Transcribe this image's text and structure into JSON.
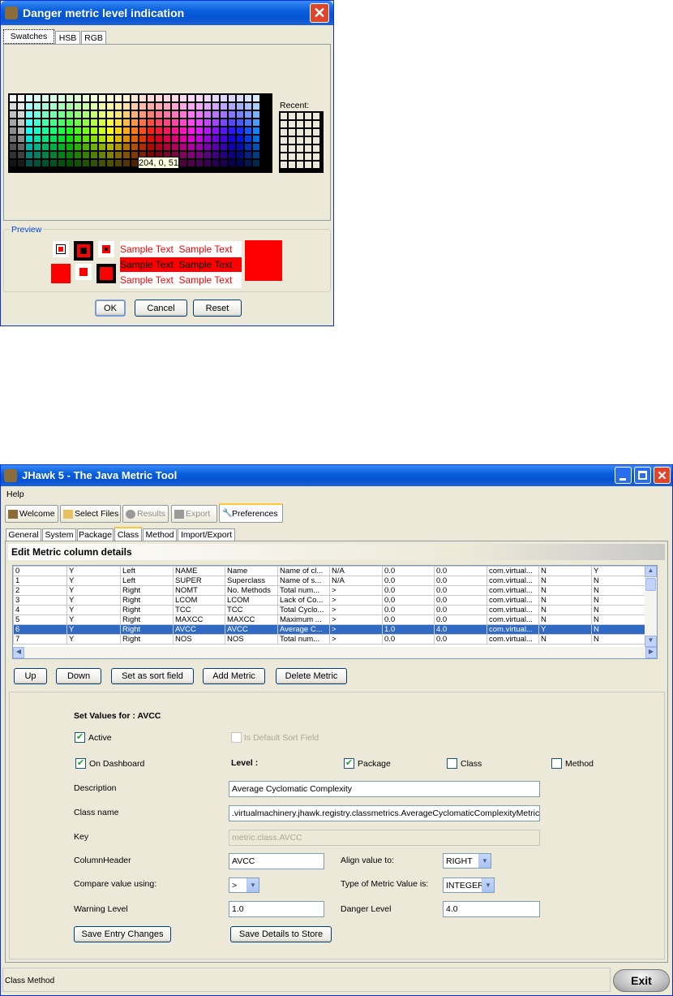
{
  "dialog": {
    "title": "Danger metric level indication",
    "tabs": [
      "Swatches",
      "HSB",
      "RGB"
    ],
    "recent_label": "Recent:",
    "tooltip": "204, 0, 51",
    "preview_label": "Preview",
    "sample_text": "Sample Text",
    "buttons": {
      "ok": "OK",
      "cancel": "Cancel",
      "reset": "Reset"
    }
  },
  "app": {
    "title": "JHawk 5 - The Java Metric Tool",
    "menu": [
      "Help"
    ],
    "main_tabs": [
      {
        "label": "Welcome",
        "icon": "hand-icon"
      },
      {
        "label": "Select Files",
        "icon": "folder-icon"
      },
      {
        "label": "Results",
        "icon": "circle-icon"
      },
      {
        "label": "Export",
        "icon": "floppy-icon"
      },
      {
        "label": "Preferences",
        "icon": "wrench-icon"
      }
    ],
    "sub_tabs": [
      "General",
      "System",
      "Package",
      "Class",
      "Method",
      "Import/Export"
    ],
    "section_title": "Edit  Metric column details",
    "table": [
      [
        "0",
        "Y",
        "Left",
        "NAME",
        "Name",
        "Name of cl...",
        "N/A",
        "0.0",
        "0.0",
        "com.virtual...",
        "N",
        "Y"
      ],
      [
        "1",
        "Y",
        "Left",
        "SUPER",
        "Superclass",
        "Name of s...",
        "N/A",
        "0.0",
        "0.0",
        "com.virtual...",
        "N",
        "N"
      ],
      [
        "2",
        "Y",
        "Right",
        "NOMT",
        "No. Methods",
        "Total num...",
        ">",
        "0.0",
        "0.0",
        "com.virtual...",
        "N",
        "N"
      ],
      [
        "3",
        "Y",
        "Right",
        "LCOM",
        "LCOM",
        "Lack of Co...",
        ">",
        "0.0",
        "0.0",
        "com.virtual...",
        "N",
        "N"
      ],
      [
        "4",
        "Y",
        "Right",
        "TCC",
        "TCC",
        "Total Cyclo...",
        ">",
        "0.0",
        "0.0",
        "com.virtual...",
        "N",
        "N"
      ],
      [
        "5",
        "Y",
        "Right",
        "MAXCC",
        "MAXCC",
        "Maximum ...",
        ">",
        "0.0",
        "0.0",
        "com.virtual...",
        "N",
        "N"
      ],
      [
        "6",
        "Y",
        "Right",
        "AVCC",
        "AVCC",
        "Average C...",
        ">",
        "1.0",
        "4.0",
        "com.virtual...",
        "Y",
        "N"
      ],
      [
        "7",
        "Y",
        "Right",
        "NOS",
        "NOS",
        "Total num...",
        ">",
        "0.0",
        "0.0",
        "com.virtual...",
        "N",
        "N"
      ]
    ],
    "selected_row": 6,
    "table_buttons": {
      "up": "Up",
      "down": "Down",
      "sort": "Set as sort field",
      "add": "Add Metric",
      "delete": "Delete Metric"
    },
    "form": {
      "set_values": "Set Values for : AVCC",
      "active": "Active",
      "default_sort": "Is Default Sort Field",
      "on_dashboard": "On Dashboard",
      "level": "Level :",
      "package": "Package",
      "class": "Class",
      "method": "Method",
      "description_label": "Description",
      "description": "Average Cyclomatic Complexity",
      "classname_label": "Class name",
      "classname": ".virtualmachinery.jhawk.registry.classmetrics.AverageCyclomaticComplexityMetric",
      "key_label": "Key",
      "key": "metric.class.AVCC",
      "column_header_label": "ColumnHeader",
      "column_header": "AVCC",
      "align_label": "Align value to:",
      "align": "RIGHT",
      "compare_label": "Compare value using:",
      "compare": ">",
      "type_label": "Type of Metric Value is:",
      "type": "INTEGER",
      "warning_label": "Warning Level",
      "warning": "1.0",
      "danger_label": "Danger Level",
      "danger": "4.0",
      "save_entry": "Save Entry Changes",
      "save_store": "Save Details to Store"
    },
    "status": "Class Method",
    "exit": "Exit"
  }
}
